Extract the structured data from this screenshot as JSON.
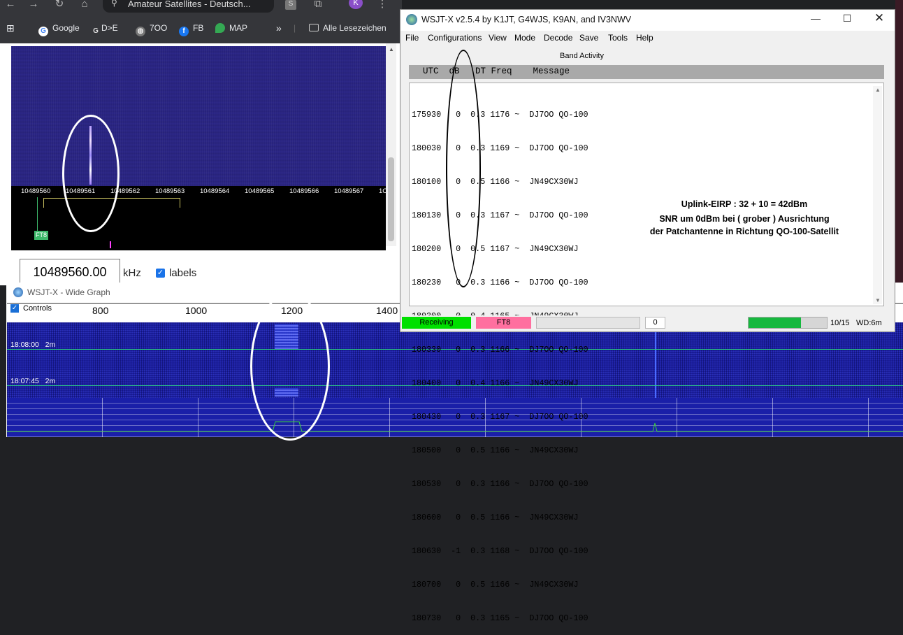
{
  "browser": {
    "tab_url_text": "Amateur Satellites - Deutsch...",
    "avatar_letter": "K",
    "bookmarks": [
      "Google",
      "D>E",
      "7OO",
      "FB",
      "MAP"
    ],
    "bookmarks_folder": "Alle Lesezeichen",
    "more": "»"
  },
  "websdr": {
    "freq_ticks": [
      "10489560",
      "10489561",
      "10489562",
      "10489563",
      "10489564",
      "10489565",
      "10489566",
      "10489567",
      "1C"
    ],
    "mode_marker": "FT8",
    "frequency_value": "10489560.00",
    "frequency_unit": "kHz",
    "labels_checkbox": "labels"
  },
  "wide_graph": {
    "title": "WSJT-X - Wide Graph",
    "controls_label": "Controls",
    "scale": [
      "800",
      "1000",
      "1200",
      "1400"
    ],
    "time_markers": [
      {
        "time": "18:08:00",
        "len": "2m"
      },
      {
        "time": "18:07:45",
        "len": "2m"
      }
    ]
  },
  "wsjt": {
    "title": "WSJT-X   v2.5.4   by K1JT, G4WJS, K9AN, and IV3NWV",
    "menus": [
      "File",
      "Configurations",
      "View",
      "Mode",
      "Decode",
      "Save",
      "Tools",
      "Help"
    ],
    "band_activity": "Band Activity",
    "header": "UTC  dB   DT Freq    Message",
    "rows": [
      "175930   0  0.3 1176 ~  DJ7OO QO-100",
      "180030   0  0.3 1169 ~  DJ7OO QO-100",
      "180100   0  0.5 1166 ~  JN49CX30WJ",
      "180130   0  0.3 1167 ~  DJ7OO QO-100",
      "180200   0  0.5 1167 ~  JN49CX30WJ",
      "180230   0  0.3 1166 ~  DJ7OO QO-100",
      "180300   0  0.4 1165 ~  JN49CX30WJ",
      "180330   0  0.3 1166 ~  DJ7OO QO-100",
      "180400   0  0.4 1166 ~  JN49CX30WJ",
      "180430   0  0.3 1167 ~  DJ7OO QO-100",
      "180500   0  0.5 1166 ~  JN49CX30WJ",
      "180530   0  0.3 1166 ~  DJ7OO QO-100",
      "180600   0  0.5 1166 ~  JN49CX30WJ",
      "180630  -1  0.3 1168 ~  DJ7OO QO-100",
      "180700   0  0.5 1166 ~  JN49CX30WJ",
      "180730   0  0.3 1165 ~  DJ7OO QO-100"
    ],
    "note_line1": "Uplink-EIRP :  32 + 10 = 42dBm",
    "note_line2": "SNR  um 0dBm  bei ( grober ) Ausrichtung",
    "note_line3": "der Patchantenne in Richtung QO-100-Satellit",
    "status": {
      "receiving": "Receiving",
      "mode": "FT8",
      "tx_count": "0",
      "progress": 0.67,
      "period": "10/15",
      "wd": "WD:6m"
    }
  },
  "colors": {
    "receiving": "#00e000",
    "mode": "#ff6f9f",
    "progress": "#16b83e"
  }
}
